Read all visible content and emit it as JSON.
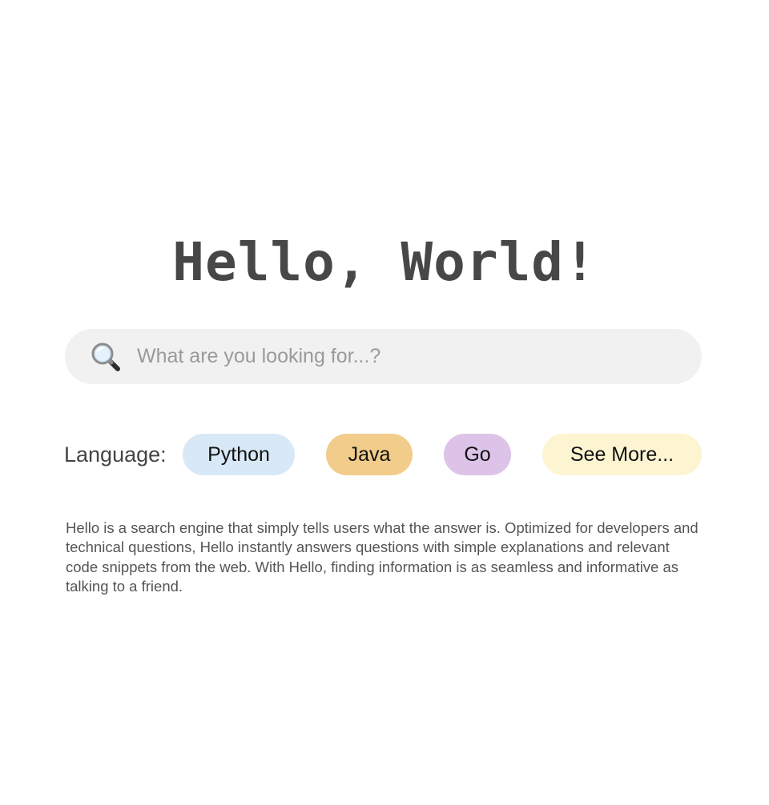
{
  "header": {
    "title": "Hello, World!"
  },
  "search": {
    "icon": "magnifying-glass-icon",
    "placeholder": "What are you looking for...?",
    "value": ""
  },
  "languages": {
    "label": "Language:",
    "options": [
      {
        "label": "Python",
        "color": "#d8e8f7"
      },
      {
        "label": "Java",
        "color": "#f1cc8b"
      },
      {
        "label": "Go",
        "color": "#dcc3e7"
      },
      {
        "label": "See More...",
        "color": "#fdf5d1"
      }
    ]
  },
  "description": "Hello is a search engine that simply tells users what the answer is. Optimized for developers and technical questions, Hello instantly answers questions with simple explanations and relevant code snippets from the web. With Hello, finding information is as seamless and informative as talking to a friend."
}
